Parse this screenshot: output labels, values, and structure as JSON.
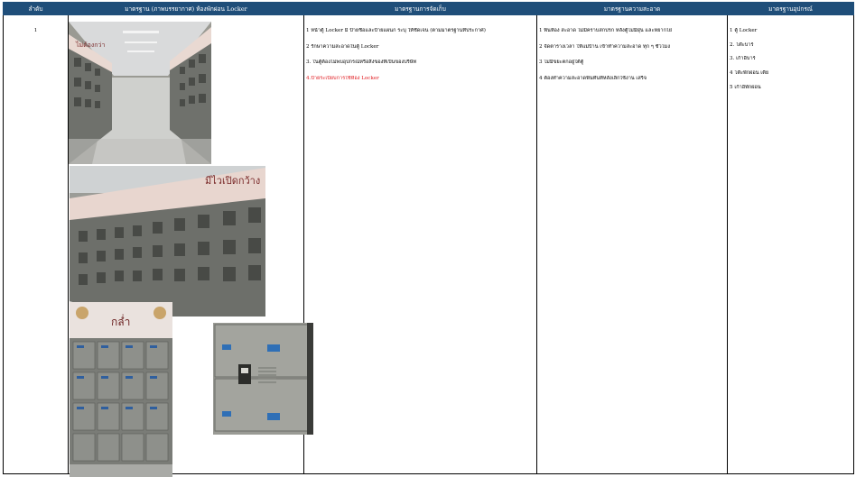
{
  "headers": {
    "seq": "ลำดับ",
    "image_std": "มาตรฐาน (ภาพบรรยากาศ) ห้องพักผ่อน Locker",
    "storage_std": "มาตรฐานการจัดเก็บ",
    "clean_std": "มาตรฐานความสะอาด",
    "equip_std": "มาตรฐานอุปกรณ์"
  },
  "row": {
    "seq": "1",
    "photos": [
      {
        "name": "locker-aisle-photo",
        "sign_text": "ไม่ต้องกว่า"
      },
      {
        "name": "locker-row-angle-photo",
        "sign_text": "มีไวเปิดกว้าง"
      },
      {
        "name": "locker-closeup-photo",
        "sign_text": "กล่ำ"
      },
      {
        "name": "locker-door-detail-photo",
        "sign_text": ""
      }
    ],
    "storage": [
      "1 หน้าตู้ Locker มี ป้ายชื่อและป้ายแผนก ระบุ ให้ชัดเจน (ตามมาตรฐานที่ประกาศ)",
      "2 รักษาความสะอาดในตู้ Locker",
      "3. ในตู้ต้องไม่พบอุปกรณ์หรือสิ่งของที่เป็นของบริษัท",
      "4.ป้ายระเบียบการใช้ห้อง Locker"
    ],
    "clean": [
      "1 พื้นห้อง สะอาด ไม่มีคราบสกปรก หลังตู้ไม่มีฝุ่น และหยากไย่",
      "2 จัดตารางเวลา ให้แม่บ้าน เข้าทำความสะอาด ทุก ๆ ชั่วโมง",
      "3 ไม่มีขยะตกอยู่ใต้ตู้",
      "4 ต้องทำความสะอาดพื้นทันทีหลังเลิกใช้งาน เสร็จ"
    ],
    "equip": [
      "1 ตู้ Locker",
      "2. โต๊ะบาร์",
      "3. เก้าอี้บาร์",
      "4 โต๊ะพักผ่อน เตี้ย",
      "5 เก้าอี้พักผ่อน"
    ]
  },
  "colors": {
    "header_bg": "#1f4e79",
    "header_text": "#ffffff",
    "highlight_text": "#e0191e",
    "border": "#000000"
  }
}
